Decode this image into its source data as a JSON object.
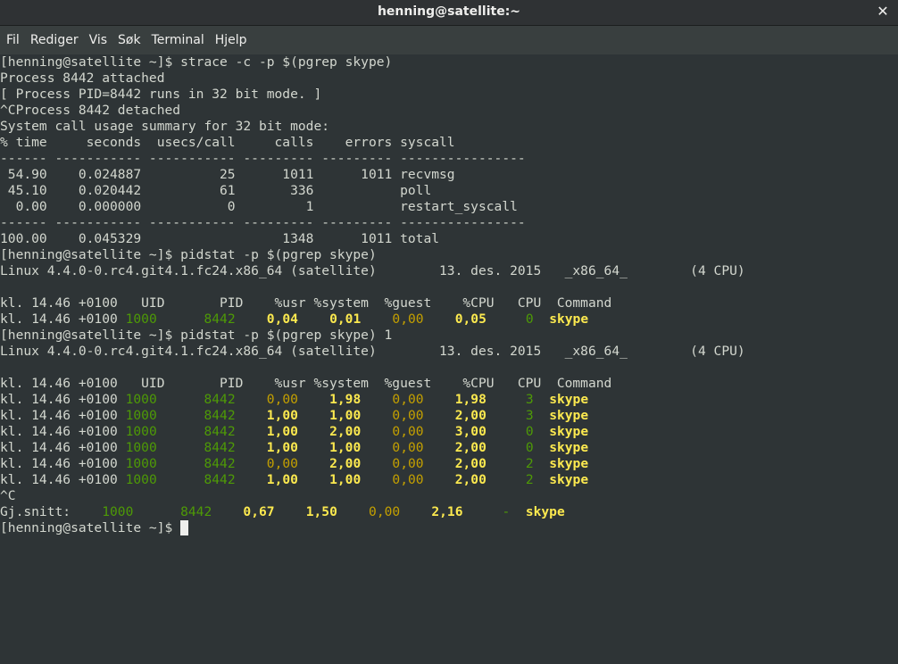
{
  "window": {
    "title": "henning@satellite:~"
  },
  "menu": {
    "items": [
      {
        "label": "Fil"
      },
      {
        "label": "Rediger"
      },
      {
        "label": "Vis"
      },
      {
        "label": "Søk"
      },
      {
        "label": "Terminal"
      },
      {
        "label": "Hjelp"
      }
    ]
  },
  "colors": {
    "background": "#2e3436",
    "text": "#d3d7cf",
    "green": "#4e9a06",
    "yellow": "#c4a000",
    "bright_yellow": "#fce94f"
  },
  "terminal": {
    "lines": [
      [
        {
          "t": "[henning@satellite ~]$ strace -c -p $(pgrep skype)"
        }
      ],
      [
        {
          "t": "Process 8442 attached"
        }
      ],
      [
        {
          "t": "[ Process PID=8442 runs in 32 bit mode. ]"
        }
      ],
      [
        {
          "t": "^CProcess 8442 detached"
        }
      ],
      [
        {
          "t": "System call usage summary for 32 bit mode:"
        }
      ],
      [
        {
          "t": "% time     seconds  usecs/call     calls    errors syscall"
        }
      ],
      [
        {
          "t": "------ ----------- ----------- --------- --------- ----------------"
        }
      ],
      [
        {
          "t": " 54.90    0.024887          25      1011      1011 recvmsg"
        }
      ],
      [
        {
          "t": " 45.10    0.020442          61       336           poll"
        }
      ],
      [
        {
          "t": "  0.00    0.000000           0         1           restart_syscall"
        }
      ],
      [
        {
          "t": "------ ----------- ----------- --------- --------- ----------------"
        }
      ],
      [
        {
          "t": "100.00    0.045329                  1348      1011 total"
        }
      ],
      [
        {
          "t": "[henning@satellite ~]$ pidstat -p $(pgrep skype)"
        }
      ],
      [
        {
          "t": "Linux 4.4.0-0.rc4.git4.1.fc24.x86_64 (satellite)        13. des. 2015   _x86_64_        (4 CPU)"
        }
      ],
      [
        {
          "t": ""
        }
      ],
      [
        {
          "t": "kl. 14.46 +0100   UID       PID    %usr %system  %guest    %CPU   CPU  Command"
        }
      ],
      [
        {
          "t": "kl. 14.46 +0100 "
        },
        {
          "t": "1000",
          "c": "green"
        },
        {
          "t": "      "
        },
        {
          "t": "8442",
          "c": "green"
        },
        {
          "t": "    "
        },
        {
          "t": "0,04",
          "c": "byellow"
        },
        {
          "t": "    "
        },
        {
          "t": "0,01",
          "c": "byellow"
        },
        {
          "t": "    "
        },
        {
          "t": "0,00",
          "c": "yellow"
        },
        {
          "t": "    "
        },
        {
          "t": "0,05",
          "c": "byellow"
        },
        {
          "t": "     "
        },
        {
          "t": "0",
          "c": "green"
        },
        {
          "t": "  "
        },
        {
          "t": "skype",
          "c": "byellow"
        }
      ],
      [
        {
          "t": "[henning@satellite ~]$ pidstat -p $(pgrep skype) 1"
        }
      ],
      [
        {
          "t": "Linux 4.4.0-0.rc4.git4.1.fc24.x86_64 (satellite)        13. des. 2015   _x86_64_        (4 CPU)"
        }
      ],
      [
        {
          "t": ""
        }
      ],
      [
        {
          "t": "kl. 14.46 +0100   UID       PID    %usr %system  %guest    %CPU   CPU  Command"
        }
      ],
      [
        {
          "t": "kl. 14.46 +0100 "
        },
        {
          "t": "1000",
          "c": "green"
        },
        {
          "t": "      "
        },
        {
          "t": "8442",
          "c": "green"
        },
        {
          "t": "    "
        },
        {
          "t": "0,00",
          "c": "yellow"
        },
        {
          "t": "    "
        },
        {
          "t": "1,98",
          "c": "byellow"
        },
        {
          "t": "    "
        },
        {
          "t": "0,00",
          "c": "yellow"
        },
        {
          "t": "    "
        },
        {
          "t": "1,98",
          "c": "byellow"
        },
        {
          "t": "     "
        },
        {
          "t": "3",
          "c": "green"
        },
        {
          "t": "  "
        },
        {
          "t": "skype",
          "c": "byellow"
        }
      ],
      [
        {
          "t": "kl. 14.46 +0100 "
        },
        {
          "t": "1000",
          "c": "green"
        },
        {
          "t": "      "
        },
        {
          "t": "8442",
          "c": "green"
        },
        {
          "t": "    "
        },
        {
          "t": "1,00",
          "c": "byellow"
        },
        {
          "t": "    "
        },
        {
          "t": "1,00",
          "c": "byellow"
        },
        {
          "t": "    "
        },
        {
          "t": "0,00",
          "c": "yellow"
        },
        {
          "t": "    "
        },
        {
          "t": "2,00",
          "c": "byellow"
        },
        {
          "t": "     "
        },
        {
          "t": "3",
          "c": "green"
        },
        {
          "t": "  "
        },
        {
          "t": "skype",
          "c": "byellow"
        }
      ],
      [
        {
          "t": "kl. 14.46 +0100 "
        },
        {
          "t": "1000",
          "c": "green"
        },
        {
          "t": "      "
        },
        {
          "t": "8442",
          "c": "green"
        },
        {
          "t": "    "
        },
        {
          "t": "1,00",
          "c": "byellow"
        },
        {
          "t": "    "
        },
        {
          "t": "2,00",
          "c": "byellow"
        },
        {
          "t": "    "
        },
        {
          "t": "0,00",
          "c": "yellow"
        },
        {
          "t": "    "
        },
        {
          "t": "3,00",
          "c": "byellow"
        },
        {
          "t": "     "
        },
        {
          "t": "0",
          "c": "green"
        },
        {
          "t": "  "
        },
        {
          "t": "skype",
          "c": "byellow"
        }
      ],
      [
        {
          "t": "kl. 14.46 +0100 "
        },
        {
          "t": "1000",
          "c": "green"
        },
        {
          "t": "      "
        },
        {
          "t": "8442",
          "c": "green"
        },
        {
          "t": "    "
        },
        {
          "t": "1,00",
          "c": "byellow"
        },
        {
          "t": "    "
        },
        {
          "t": "1,00",
          "c": "byellow"
        },
        {
          "t": "    "
        },
        {
          "t": "0,00",
          "c": "yellow"
        },
        {
          "t": "    "
        },
        {
          "t": "2,00",
          "c": "byellow"
        },
        {
          "t": "     "
        },
        {
          "t": "0",
          "c": "green"
        },
        {
          "t": "  "
        },
        {
          "t": "skype",
          "c": "byellow"
        }
      ],
      [
        {
          "t": "kl. 14.46 +0100 "
        },
        {
          "t": "1000",
          "c": "green"
        },
        {
          "t": "      "
        },
        {
          "t": "8442",
          "c": "green"
        },
        {
          "t": "    "
        },
        {
          "t": "0,00",
          "c": "yellow"
        },
        {
          "t": "    "
        },
        {
          "t": "2,00",
          "c": "byellow"
        },
        {
          "t": "    "
        },
        {
          "t": "0,00",
          "c": "yellow"
        },
        {
          "t": "    "
        },
        {
          "t": "2,00",
          "c": "byellow"
        },
        {
          "t": "     "
        },
        {
          "t": "2",
          "c": "green"
        },
        {
          "t": "  "
        },
        {
          "t": "skype",
          "c": "byellow"
        }
      ],
      [
        {
          "t": "kl. 14.46 +0100 "
        },
        {
          "t": "1000",
          "c": "green"
        },
        {
          "t": "      "
        },
        {
          "t": "8442",
          "c": "green"
        },
        {
          "t": "    "
        },
        {
          "t": "1,00",
          "c": "byellow"
        },
        {
          "t": "    "
        },
        {
          "t": "1,00",
          "c": "byellow"
        },
        {
          "t": "    "
        },
        {
          "t": "0,00",
          "c": "yellow"
        },
        {
          "t": "    "
        },
        {
          "t": "2,00",
          "c": "byellow"
        },
        {
          "t": "     "
        },
        {
          "t": "2",
          "c": "green"
        },
        {
          "t": "  "
        },
        {
          "t": "skype",
          "c": "byellow"
        }
      ],
      [
        {
          "t": "^C"
        }
      ],
      [
        {
          "t": "Gj.snitt:    "
        },
        {
          "t": "1000",
          "c": "green"
        },
        {
          "t": "      "
        },
        {
          "t": "8442",
          "c": "green"
        },
        {
          "t": "    "
        },
        {
          "t": "0,67",
          "c": "byellow"
        },
        {
          "t": "    "
        },
        {
          "t": "1,50",
          "c": "byellow"
        },
        {
          "t": "    "
        },
        {
          "t": "0,00",
          "c": "yellow"
        },
        {
          "t": "    "
        },
        {
          "t": "2,16",
          "c": "byellow"
        },
        {
          "t": "     "
        },
        {
          "t": "-",
          "c": "green"
        },
        {
          "t": "  "
        },
        {
          "t": "skype",
          "c": "byellow"
        }
      ],
      [
        {
          "t": "[henning@satellite ~]$ "
        }
      ]
    ]
  }
}
